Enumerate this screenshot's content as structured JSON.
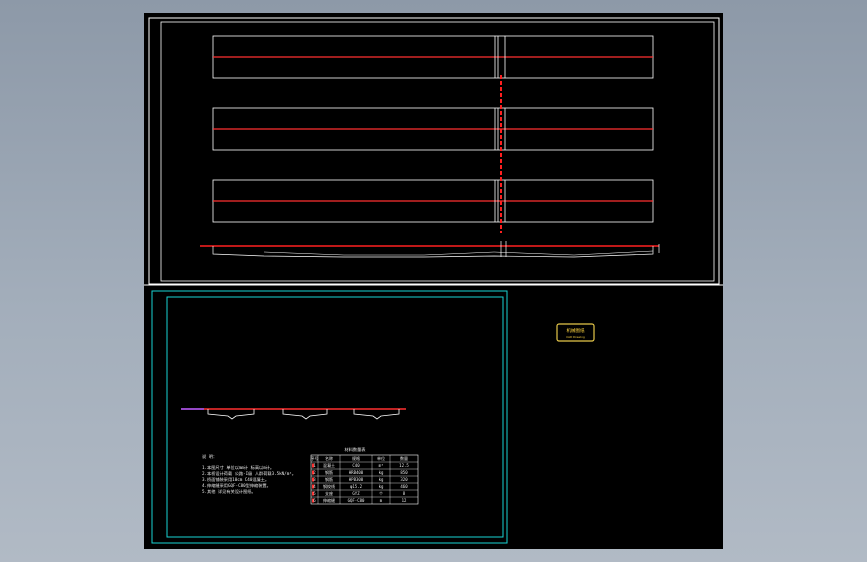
{
  "title_block": {
    "stamp_main": "机械图纸",
    "stamp_sub": "CAD Drawing"
  },
  "detail_sheet": {
    "notes_heading": "说 明：",
    "notes": [
      "1.本图尺寸 单位以mm计 标高以m计。",
      "2.本桥设计荷载 公路-I级 人群荷载3.5kN/m²。",
      "3.桥面铺装采用10cm C40混凝土。",
      "4.伸缩缝采用GQF-C80型伸缩装置。",
      "5.其他 详见有关设计图纸。"
    ],
    "table_title": "材料数量表",
    "table_headers": [
      "序号",
      "名称",
      "规格",
      "单位",
      "数量"
    ],
    "table_rows": [
      [
        "1",
        "混凝土",
        "C40",
        "m³",
        "12.5"
      ],
      [
        "2",
        "钢筋",
        "HRB400",
        "kg",
        "850"
      ],
      [
        "3",
        "钢筋",
        "HPB300",
        "kg",
        "320"
      ],
      [
        "4",
        "钢绞线",
        "φ15.2",
        "kg",
        "460"
      ],
      [
        "5",
        "支座",
        "GYZ",
        "个",
        "8"
      ],
      [
        "6",
        "伸缩缝",
        "GQF-C80",
        "m",
        "12"
      ]
    ]
  },
  "colors": {
    "background_top": "#8d99a8",
    "canvas": "#000000",
    "line_white": "#ffffff",
    "line_red": "#ff2020",
    "sheet_cyan": "#19d3d3",
    "stamp_yellow": "#e6c84a"
  }
}
